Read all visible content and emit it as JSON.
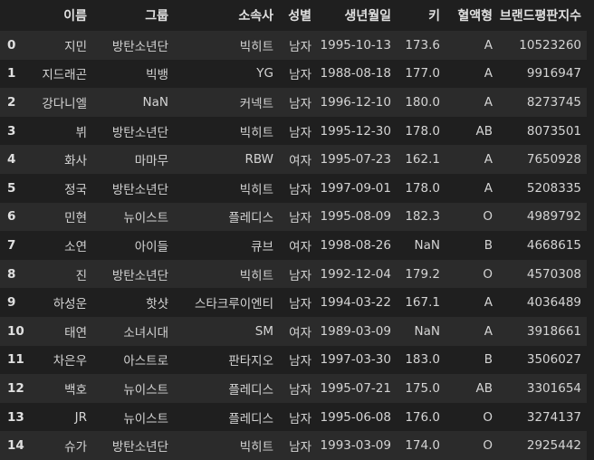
{
  "table": {
    "columns": [
      "",
      "이름",
      "그룹",
      "소속사",
      "성별",
      "생년월일",
      "키",
      "혈액형",
      "브랜드평판지수"
    ],
    "rows": [
      [
        "0",
        "지민",
        "방탄소년단",
        "빅히트",
        "남자",
        "1995-10-13",
        "173.6",
        "A",
        "10523260"
      ],
      [
        "1",
        "지드래곤",
        "빅뱅",
        "YG",
        "남자",
        "1988-08-18",
        "177.0",
        "A",
        "9916947"
      ],
      [
        "2",
        "강다니엘",
        "NaN",
        "커넥트",
        "남자",
        "1996-12-10",
        "180.0",
        "A",
        "8273745"
      ],
      [
        "3",
        "뷔",
        "방탄소년단",
        "빅히트",
        "남자",
        "1995-12-30",
        "178.0",
        "AB",
        "8073501"
      ],
      [
        "4",
        "화사",
        "마마무",
        "RBW",
        "여자",
        "1995-07-23",
        "162.1",
        "A",
        "7650928"
      ],
      [
        "5",
        "정국",
        "방탄소년단",
        "빅히트",
        "남자",
        "1997-09-01",
        "178.0",
        "A",
        "5208335"
      ],
      [
        "6",
        "민현",
        "뉴이스트",
        "플레디스",
        "남자",
        "1995-08-09",
        "182.3",
        "O",
        "4989792"
      ],
      [
        "7",
        "소연",
        "아이들",
        "큐브",
        "여자",
        "1998-08-26",
        "NaN",
        "B",
        "4668615"
      ],
      [
        "8",
        "진",
        "방탄소년단",
        "빅히트",
        "남자",
        "1992-12-04",
        "179.2",
        "O",
        "4570308"
      ],
      [
        "9",
        "하성운",
        "핫샷",
        "스타크루이엔티",
        "남자",
        "1994-03-22",
        "167.1",
        "A",
        "4036489"
      ],
      [
        "10",
        "태연",
        "소녀시대",
        "SM",
        "여자",
        "1989-03-09",
        "NaN",
        "A",
        "3918661"
      ],
      [
        "11",
        "차은우",
        "아스트로",
        "판타지오",
        "남자",
        "1997-03-30",
        "183.0",
        "B",
        "3506027"
      ],
      [
        "12",
        "백호",
        "뉴이스트",
        "플레디스",
        "남자",
        "1995-07-21",
        "175.0",
        "AB",
        "3301654"
      ],
      [
        "13",
        "JR",
        "뉴이스트",
        "플레디스",
        "남자",
        "1995-06-08",
        "176.0",
        "O",
        "3274137"
      ],
      [
        "14",
        "슈가",
        "방탄소년단",
        "빅히트",
        "남자",
        "1993-03-09",
        "174.0",
        "O",
        "2925442"
      ]
    ]
  }
}
